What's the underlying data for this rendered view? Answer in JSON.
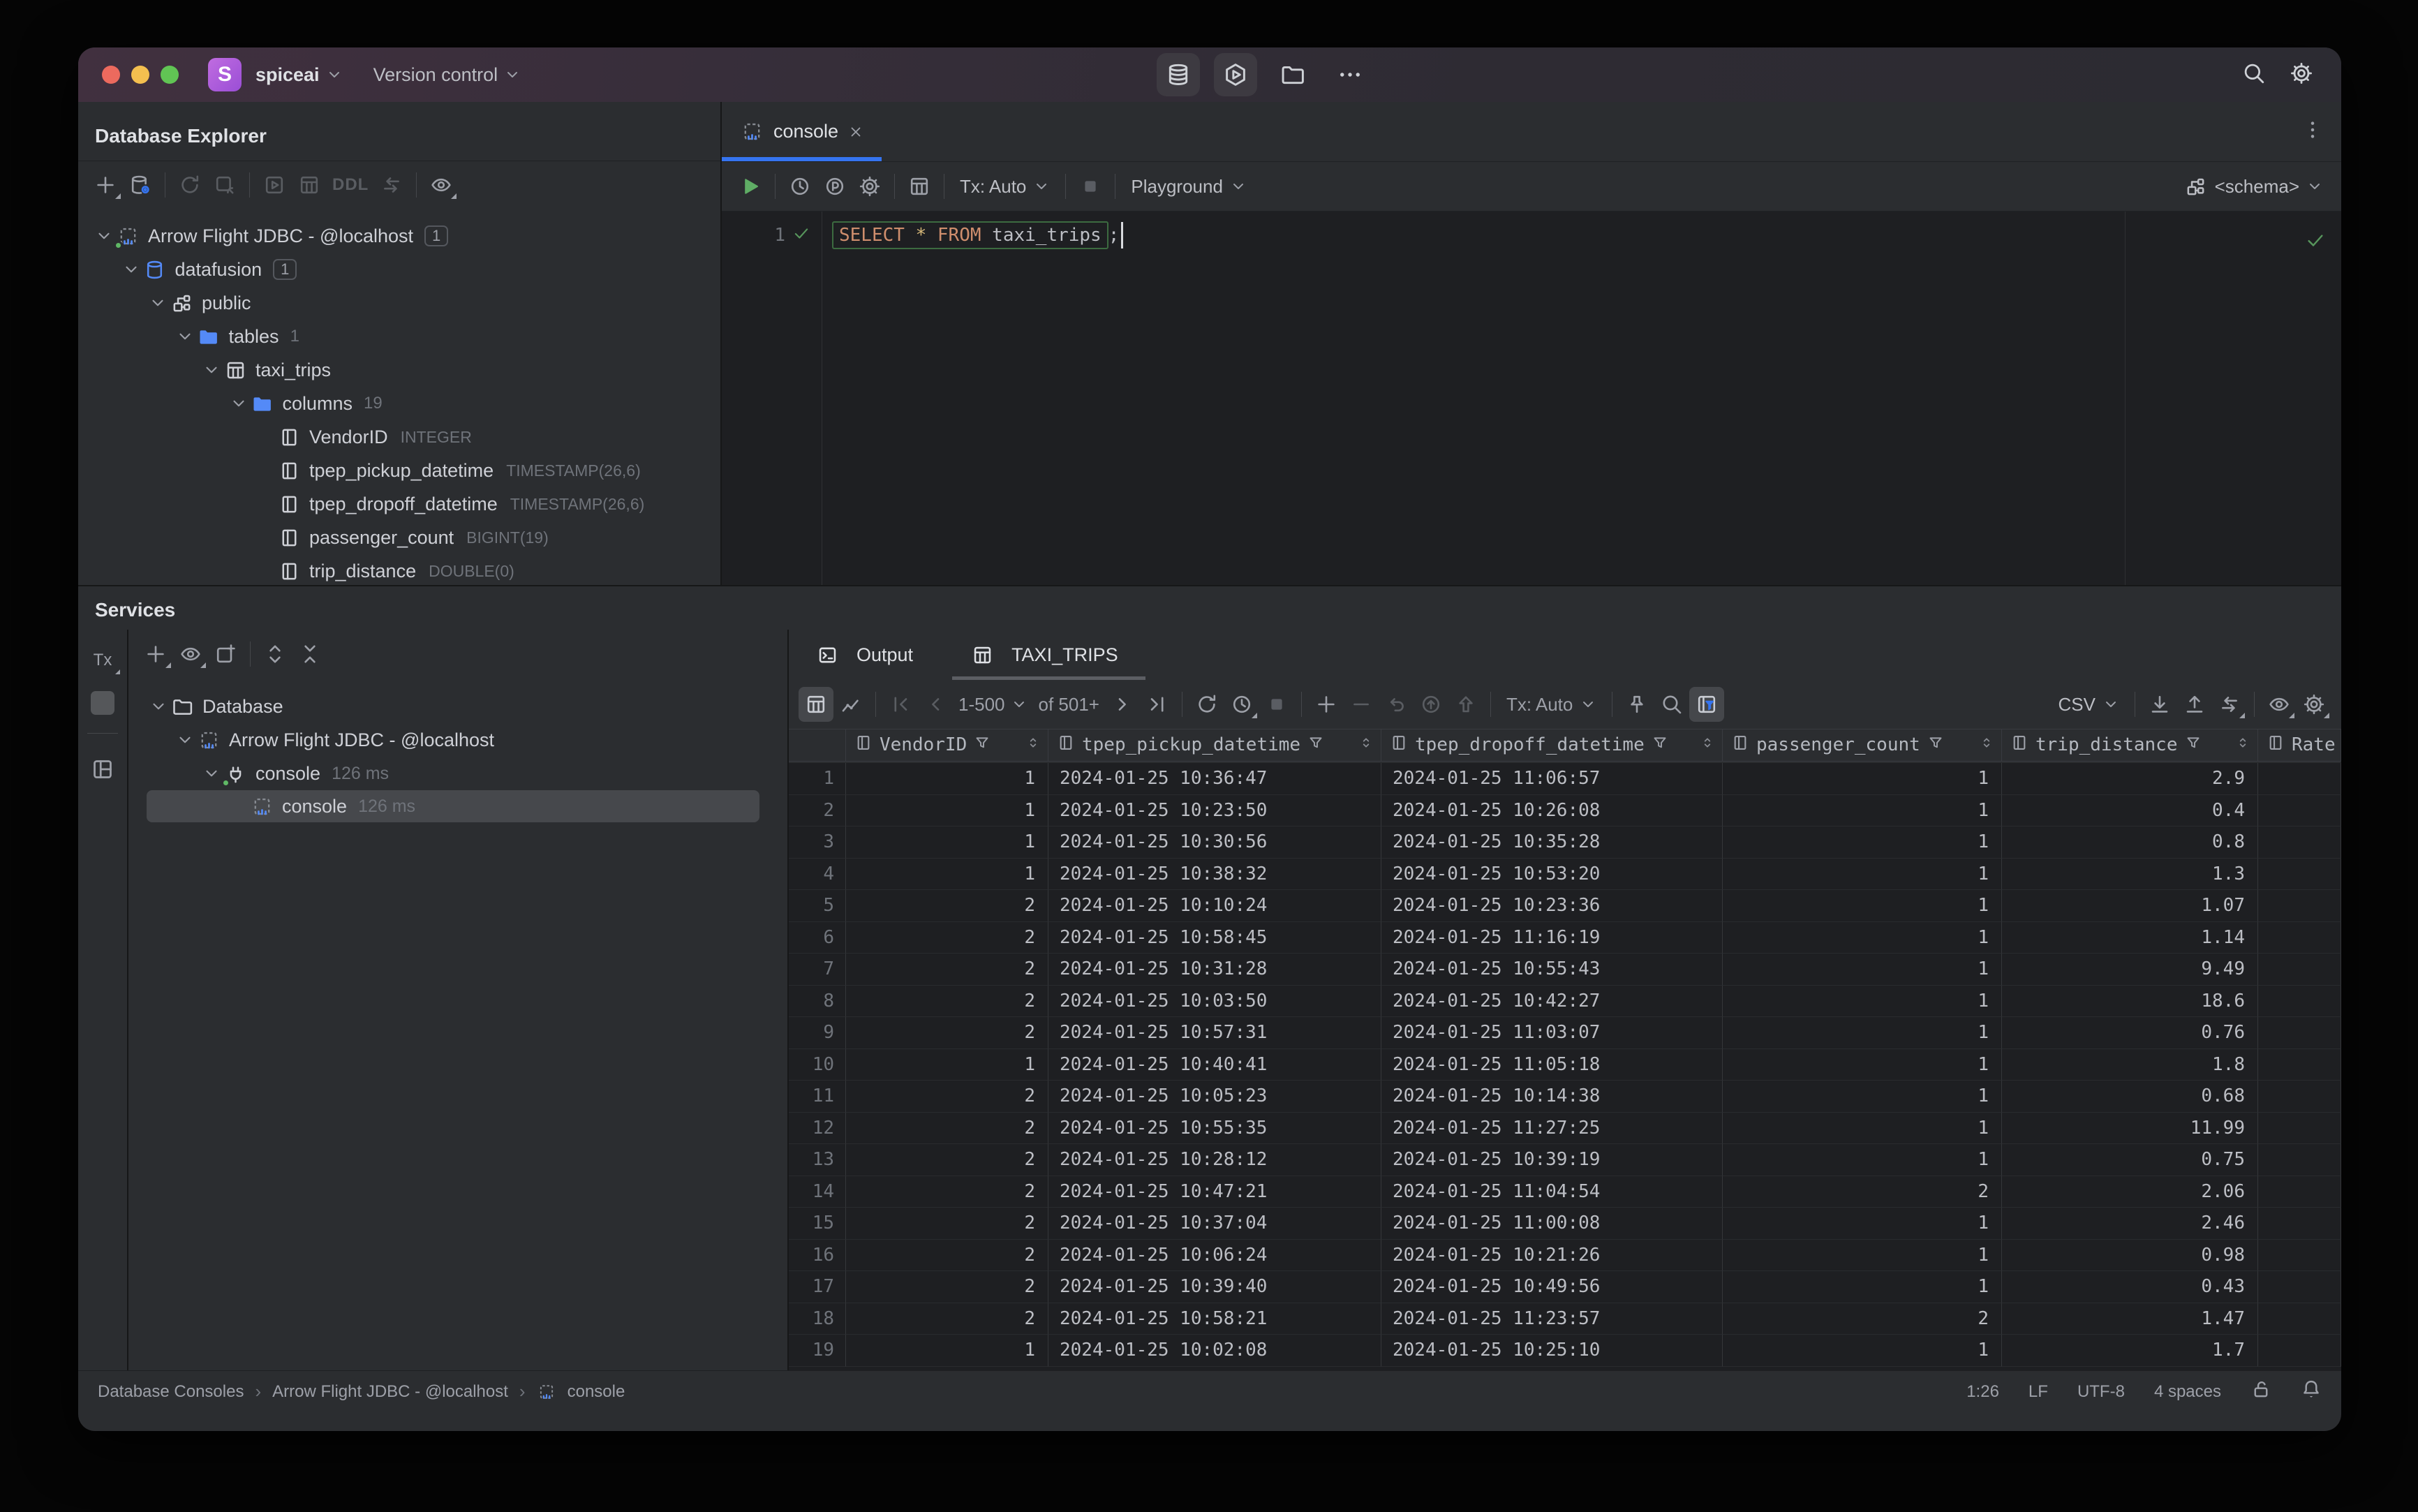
{
  "palette": {
    "accent_blue": "#3574F0",
    "run_green": "#5FAD65",
    "check_green": "#57965C",
    "folder_blue": "#548AF7",
    "keyword_orange": "#CF8E6D",
    "star_yellow": "#D5B778",
    "titlebar_tint": "#41303F",
    "traffic_red": "#EC6A5E",
    "traffic_yellow": "#F4BF4F",
    "traffic_green": "#61C454",
    "panel_bg": "#2B2D30",
    "editor_bg": "#1E1F22"
  },
  "icons": {
    "titlebar": [
      "close-icon",
      "minimize-icon",
      "zoom-icon",
      "app-logo-s",
      "chevron-down-icon",
      "database-stack-icon",
      "hexagon-play-icon",
      "folder-icon",
      "more-horizontal-icon",
      "search-icon",
      "settings-icon"
    ],
    "explorer_toolbar": [
      "add-icon",
      "datasource-settings-icon",
      "refresh-icon",
      "disconnect-icon",
      "run-frame-icon",
      "table-icon",
      "jump-to-icon",
      "eye-icon"
    ],
    "results_toolbar": [
      "grid-view-icon",
      "chart-view-icon",
      "first-page-icon",
      "prev-page-icon",
      "next-page-icon",
      "last-page-icon",
      "reload-icon",
      "auto-refresh-icon",
      "stop-icon",
      "add-row-icon",
      "delete-row-icon",
      "undo-icon",
      "submit-icon",
      "upload-icon",
      "pin-icon",
      "search-icon",
      "filter-panel-icon",
      "download-icon",
      "export-icon",
      "jump-to-icon",
      "eye-icon",
      "settings-icon"
    ],
    "status_bar": [
      "lock-open-icon",
      "bell-icon"
    ]
  },
  "titlebar": {
    "app_name": "spiceai",
    "menu_version_control": "Version control"
  },
  "database_explorer": {
    "title": "Database Explorer",
    "ddl_label": "DDL",
    "tree": [
      {
        "label": "Arrow Flight JDBC - @localhost",
        "type": "datasource",
        "depth": 0,
        "badge": "1",
        "expanded": true
      },
      {
        "label": "datafusion",
        "type": "database",
        "depth": 1,
        "badge": "1",
        "expanded": true
      },
      {
        "label": "public",
        "type": "schema",
        "depth": 2,
        "expanded": true
      },
      {
        "label": "tables",
        "type": "folder",
        "depth": 3,
        "count": "1",
        "expanded": true
      },
      {
        "label": "taxi_trips",
        "type": "table",
        "depth": 4,
        "expanded": true
      },
      {
        "label": "columns",
        "type": "folder",
        "depth": 5,
        "count": "19",
        "expanded": true
      },
      {
        "label": "VendorID",
        "type": "column",
        "depth": 6,
        "dtype": "INTEGER"
      },
      {
        "label": "tpep_pickup_datetime",
        "type": "column",
        "depth": 6,
        "dtype": "TIMESTAMP(26,6)"
      },
      {
        "label": "tpep_dropoff_datetime",
        "type": "column",
        "depth": 6,
        "dtype": "TIMESTAMP(26,6)"
      },
      {
        "label": "passenger_count",
        "type": "column",
        "depth": 6,
        "dtype": "BIGINT(19)"
      },
      {
        "label": "trip_distance",
        "type": "column",
        "depth": 6,
        "dtype": "DOUBLE(0)"
      }
    ]
  },
  "editor": {
    "tab_label": "console",
    "tx_label": "Tx: Auto",
    "target_label": "Playground",
    "schema_label": "<schema>",
    "line_number": "1",
    "sql_tokens": {
      "kw1": "SELECT",
      "star": "*",
      "kw2": "FROM",
      "ident": "taxi_trips",
      "semi": ";"
    }
  },
  "services": {
    "title": "Services",
    "tx_strip_label": "Tx",
    "tree": [
      {
        "label": "Database",
        "type": "folder-gray",
        "depth": 0,
        "expanded": true
      },
      {
        "label": "Arrow Flight JDBC - @localhost",
        "type": "console-file",
        "depth": 1,
        "expanded": true
      },
      {
        "label": "console",
        "type": "plug",
        "depth": 2,
        "time": "126 ms",
        "expanded": true
      },
      {
        "label": "console",
        "type": "console-file",
        "depth": 3,
        "time": "126 ms",
        "selected": true
      }
    ]
  },
  "results": {
    "tabs": {
      "output": "Output",
      "result": "TAXI_TRIPS"
    },
    "toolbar": {
      "page_range": "1-500",
      "page_of": "of 501+",
      "tx_label": "Tx: Auto",
      "export_label": "CSV"
    },
    "grid": {
      "columns": [
        {
          "name": "VendorID",
          "align": "right"
        },
        {
          "name": "tpep_pickup_datetime",
          "align": "left"
        },
        {
          "name": "tpep_dropoff_datetime",
          "align": "left"
        },
        {
          "name": "passenger_count",
          "align": "right"
        },
        {
          "name": "trip_distance",
          "align": "right"
        },
        {
          "name": "Rate",
          "align": "left",
          "clipped": true
        }
      ],
      "rows": [
        [
          "1",
          "1",
          "2024-01-25 10:36:47",
          "2024-01-25 11:06:57",
          "1",
          "2.9",
          ""
        ],
        [
          "2",
          "1",
          "2024-01-25 10:23:50",
          "2024-01-25 10:26:08",
          "1",
          "0.4",
          ""
        ],
        [
          "3",
          "1",
          "2024-01-25 10:30:56",
          "2024-01-25 10:35:28",
          "1",
          "0.8",
          ""
        ],
        [
          "4",
          "1",
          "2024-01-25 10:38:32",
          "2024-01-25 10:53:20",
          "1",
          "1.3",
          ""
        ],
        [
          "5",
          "2",
          "2024-01-25 10:10:24",
          "2024-01-25 10:23:36",
          "1",
          "1.07",
          ""
        ],
        [
          "6",
          "2",
          "2024-01-25 10:58:45",
          "2024-01-25 11:16:19",
          "1",
          "1.14",
          ""
        ],
        [
          "7",
          "2",
          "2024-01-25 10:31:28",
          "2024-01-25 10:55:43",
          "1",
          "9.49",
          ""
        ],
        [
          "8",
          "2",
          "2024-01-25 10:03:50",
          "2024-01-25 10:42:27",
          "1",
          "18.6",
          ""
        ],
        [
          "9",
          "2",
          "2024-01-25 10:57:31",
          "2024-01-25 11:03:07",
          "1",
          "0.76",
          ""
        ],
        [
          "10",
          "1",
          "2024-01-25 10:40:41",
          "2024-01-25 11:05:18",
          "1",
          "1.8",
          ""
        ],
        [
          "11",
          "2",
          "2024-01-25 10:05:23",
          "2024-01-25 10:14:38",
          "1",
          "0.68",
          ""
        ],
        [
          "12",
          "2",
          "2024-01-25 10:55:35",
          "2024-01-25 11:27:25",
          "1",
          "11.99",
          ""
        ],
        [
          "13",
          "2",
          "2024-01-25 10:28:12",
          "2024-01-25 10:39:19",
          "1",
          "0.75",
          ""
        ],
        [
          "14",
          "2",
          "2024-01-25 10:47:21",
          "2024-01-25 11:04:54",
          "2",
          "2.06",
          ""
        ],
        [
          "15",
          "2",
          "2024-01-25 10:37:04",
          "2024-01-25 11:00:08",
          "1",
          "2.46",
          ""
        ],
        [
          "16",
          "2",
          "2024-01-25 10:06:24",
          "2024-01-25 10:21:26",
          "1",
          "0.98",
          ""
        ],
        [
          "17",
          "2",
          "2024-01-25 10:39:40",
          "2024-01-25 10:49:56",
          "1",
          "0.43",
          ""
        ],
        [
          "18",
          "2",
          "2024-01-25 10:58:21",
          "2024-01-25 11:23:57",
          "2",
          "1.47",
          ""
        ],
        [
          "19",
          "1",
          "2024-01-25 10:02:08",
          "2024-01-25 10:25:10",
          "1",
          "1.7",
          ""
        ]
      ]
    }
  },
  "status_bar": {
    "breadcrumbs": [
      "Database Consoles",
      "Arrow Flight JDBC - @localhost",
      "console"
    ],
    "caret_position": "1:26",
    "line_separator": "LF",
    "encoding": "UTF-8",
    "indent": "4 spaces"
  }
}
